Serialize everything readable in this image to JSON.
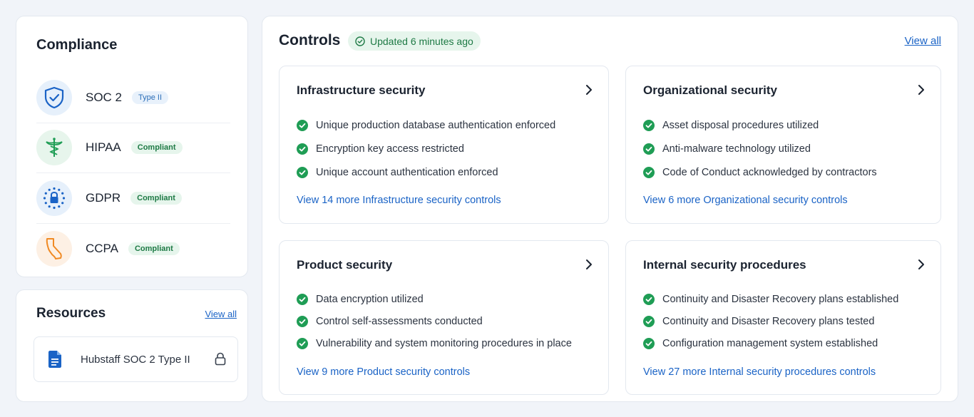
{
  "compliance": {
    "title": "Compliance",
    "frameworks": [
      {
        "name": "SOC 2",
        "badge": "Type II",
        "icon": "shield-check-icon"
      },
      {
        "name": "HIPAA",
        "badge": "Compliant",
        "icon": "caduceus-icon"
      },
      {
        "name": "GDPR",
        "badge": "Compliant",
        "icon": "eu-lock-icon"
      },
      {
        "name": "CCPA",
        "badge": "Compliant",
        "icon": "california-icon"
      }
    ]
  },
  "resources": {
    "title": "Resources",
    "view_all": "View all",
    "items": [
      {
        "name": "Hubstaff SOC 2 Type II",
        "icon": "document-icon",
        "locked_icon": "lock-icon"
      }
    ]
  },
  "controls": {
    "title": "Controls",
    "updated": "Updated 6 minutes ago",
    "view_all": "View all",
    "cards": [
      {
        "title": "Infrastructure security",
        "items": [
          "Unique production database authentication enforced",
          "Encryption key access restricted",
          "Unique account authentication enforced"
        ],
        "more": "View 14 more Infrastructure security controls"
      },
      {
        "title": "Organizational security",
        "items": [
          "Asset disposal procedures utilized",
          "Anti-malware technology utilized",
          "Code of Conduct acknowledged by contractors"
        ],
        "more": "View 6 more Organizational security controls"
      },
      {
        "title": "Product security",
        "items": [
          "Data encryption utilized",
          "Control self-assessments conducted",
          "Vulnerability and system monitoring procedures in place"
        ],
        "more": "View 9 more Product security controls"
      },
      {
        "title": "Internal security procedures",
        "items": [
          "Continuity and Disaster Recovery plans established",
          "Continuity and Disaster Recovery plans tested",
          "Configuration management system established"
        ],
        "more": "View 27 more Internal security procedures controls"
      }
    ]
  },
  "colors": {
    "accent": "#1a63c6",
    "success": "#1f9d55",
    "background": "#f1f4f9"
  }
}
